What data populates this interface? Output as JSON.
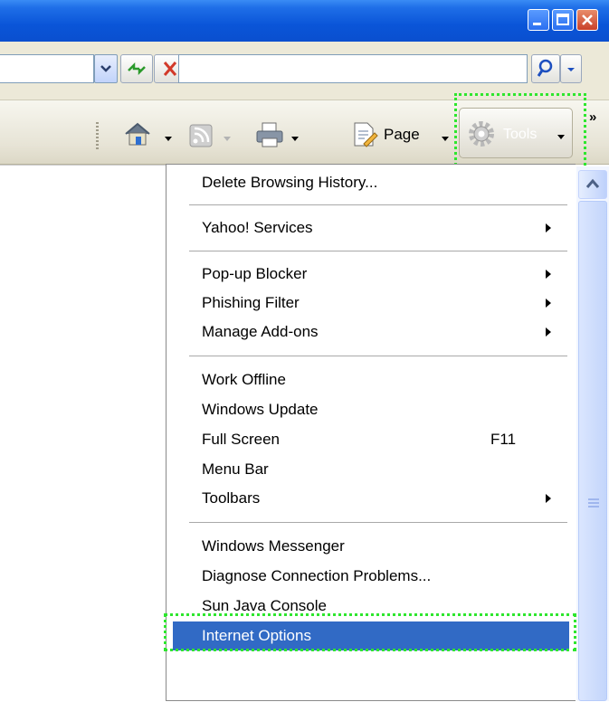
{
  "title_bar": {
    "buttons": [
      "minimize-icon",
      "maximize-icon",
      "close-icon"
    ],
    "colors": {
      "bar": "#0a55d8",
      "close": "#c9412a"
    }
  },
  "address_bar": {
    "address_value": "",
    "search_value": "",
    "icons": [
      "dropdown-arrow-icon",
      "refresh-icon",
      "stop-icon",
      "search-icon",
      "search-options-icon"
    ]
  },
  "command_bar": {
    "page_label": "Page",
    "tools_label": "Tools",
    "overflow_label": "»",
    "icons": [
      "home-icon",
      "feeds-icon",
      "print-icon",
      "page-icon",
      "gear-icon"
    ]
  },
  "tools_menu": {
    "groups": [
      [
        {
          "label": "Delete Browsing History...",
          "shortcut": "",
          "submenu": false
        }
      ],
      [
        {
          "label": "Yahoo! Services",
          "shortcut": "",
          "submenu": true
        }
      ],
      [
        {
          "label": "Pop-up Blocker",
          "shortcut": "",
          "submenu": true
        },
        {
          "label": "Phishing Filter",
          "shortcut": "",
          "submenu": true
        },
        {
          "label": "Manage Add-ons",
          "shortcut": "",
          "submenu": true
        }
      ],
      [
        {
          "label": "Work Offline",
          "shortcut": "",
          "submenu": false
        },
        {
          "label": "Windows Update",
          "shortcut": "",
          "submenu": false
        },
        {
          "label": "Full Screen",
          "shortcut": "F11",
          "submenu": false
        },
        {
          "label": "Menu Bar",
          "shortcut": "",
          "submenu": false
        },
        {
          "label": "Toolbars",
          "shortcut": "",
          "submenu": true
        }
      ],
      [
        {
          "label": "Windows Messenger",
          "shortcut": "",
          "submenu": false
        },
        {
          "label": "Diagnose Connection Problems...",
          "shortcut": "",
          "submenu": false
        },
        {
          "label": "Sun Java Console",
          "shortcut": "",
          "submenu": false
        }
      ],
      [
        {
          "label": "Internet Options",
          "shortcut": "",
          "submenu": false,
          "selected": true
        }
      ]
    ],
    "selection_color": "#316ac5"
  },
  "annotations": {
    "highlight_color": "#2ee62e"
  }
}
